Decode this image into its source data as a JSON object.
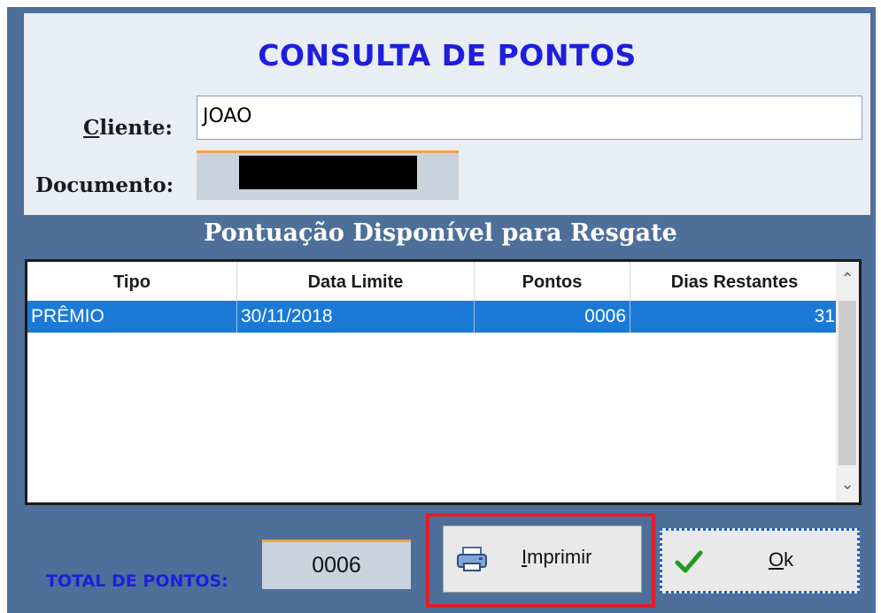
{
  "title": "CONSULTA DE PONTOS",
  "cliente": {
    "label_first": "C",
    "label_rest": "liente:",
    "value": "JOAO"
  },
  "documento": {
    "label": "Documento:"
  },
  "subtitle": "Pontuação Disponível para Resgate",
  "grid": {
    "columns": [
      "Tipo",
      "Data Limite",
      "Pontos",
      "Dias Restantes"
    ],
    "rows": [
      {
        "tipo": "PRÊMIO",
        "data_limite": "30/11/2018",
        "pontos": "0006",
        "dias_restantes": "31"
      }
    ]
  },
  "total": {
    "label": "TOTAL DE  PONTOS:",
    "value": "0006"
  },
  "buttons": {
    "print": {
      "label_first": "I",
      "label_rest": "mprimir",
      "icon": "printer-icon"
    },
    "ok": {
      "label_first": "O",
      "label_rest": "k",
      "icon": "check-icon"
    }
  },
  "colors": {
    "accent_blue": "#1e1edc",
    "frame": "#4e6f99",
    "selected_row": "#1b7ad6",
    "highlight": "#e01e2c",
    "field_top": "#f0a64a"
  }
}
